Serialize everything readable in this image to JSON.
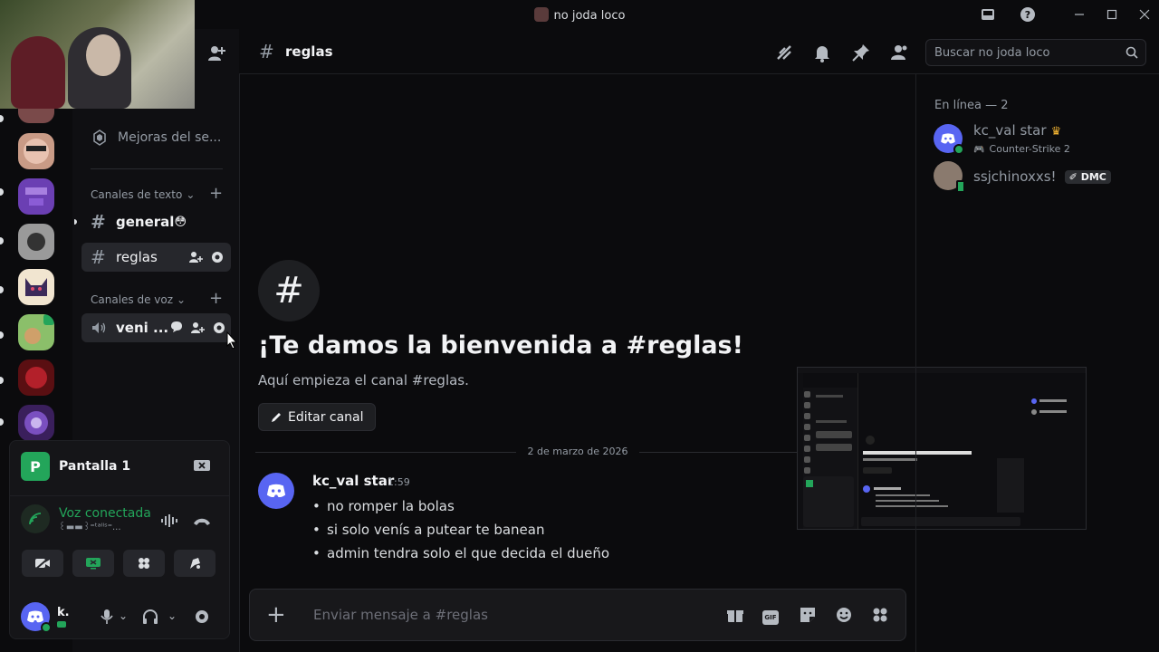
{
  "window": {
    "title": "no joda loco",
    "buttons": [
      "inbox",
      "help",
      "minimize",
      "maximize",
      "close"
    ]
  },
  "server": {
    "boost_label": "Mejoras del se...",
    "text_category": "Canales de texto",
    "voice_category": "Canales de voz",
    "text_channels": [
      {
        "name": "general",
        "emoji": "😳"
      },
      {
        "name": "reglas"
      }
    ],
    "voice_channels": [
      {
        "name": "veni ..."
      }
    ]
  },
  "voice_panel": {
    "stream_label": "Pantalla 1",
    "connected_label": "Voz conectada",
    "connected_sub": "꒰▬▬꒱⁼ᵗᵃˡˡˢ⁼...",
    "user_short": "k."
  },
  "header": {
    "channel_name": "reglas",
    "search_placeholder": "Buscar no joda loco"
  },
  "welcome": {
    "hash": "#",
    "title": "¡Te damos la bienvenida a #reglas!",
    "subtitle": "Aquí empieza el canal #reglas.",
    "edit_button": "Editar canal"
  },
  "messages": {
    "date": "2 de marzo de 2026",
    "author": "kc_val star",
    "time": "1:59",
    "lines": [
      "no romper la bolas",
      "si solo venís a putear te banean",
      "admin tendra solo el que decida el dueño"
    ]
  },
  "composer": {
    "placeholder": "Enviar mensaje a #reglas",
    "gif_label": "GIF"
  },
  "members": {
    "heading": "En línea — 2",
    "list": [
      {
        "name": "kc_val star",
        "activity": "Counter-Strike 2",
        "crown": "♛"
      },
      {
        "name": "ssjchinoxxs!",
        "badge": "DMC"
      }
    ]
  },
  "colors": {
    "accent": "#5865f2",
    "online": "#23a55a",
    "background": "#0b0b0d"
  }
}
